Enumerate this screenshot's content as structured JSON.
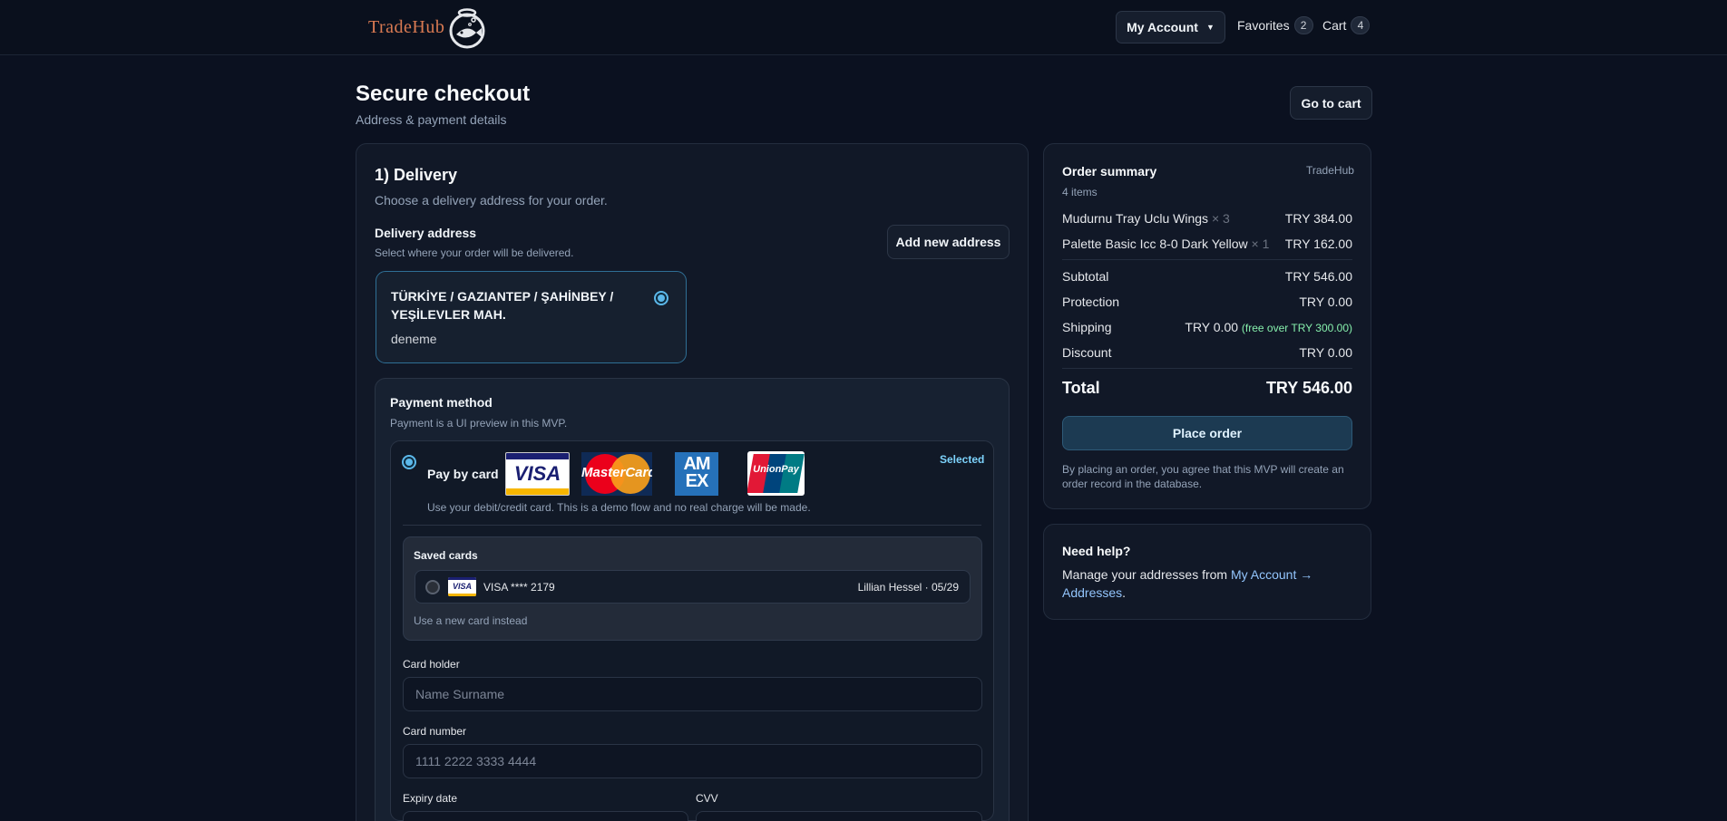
{
  "header": {
    "logo_text": "TradeHub",
    "account_label": "My Account",
    "favorites_label": "Favorites",
    "favorites_count": "2",
    "cart_label": "Cart",
    "cart_count": "4"
  },
  "page": {
    "title": "Secure checkout",
    "subtitle": "Address & payment details",
    "go_to_cart": "Go to cart"
  },
  "delivery": {
    "heading": "1) Delivery",
    "description": "Choose a delivery address for your order.",
    "address_label": "Delivery address",
    "address_help": "Select where your order will be delivered.",
    "add_new_address": "Add new address",
    "selected_address_line1": "TÜRKİYE / GAZIANTEP / ŞAHİNBEY /",
    "selected_address_line2": "YEŞİLEVLER MAH.",
    "selected_address_note": "deneme"
  },
  "payment": {
    "heading": "Payment method",
    "note": "Payment is a UI preview in this MVP.",
    "option_label": "Pay by card",
    "selected_badge": "Selected",
    "option_description": "Use your debit/credit card. This is a demo flow and no real charge will be made.",
    "card_brands": [
      "VISA",
      "MasterCard",
      "AM EX",
      "UnionPay"
    ],
    "saved_cards_heading": "Saved cards",
    "saved_card_label": "VISA **** 2179",
    "saved_card_owner": "Lillian Hessel · 05/29",
    "use_new_card": "Use a new card instead",
    "card_holder_label": "Card holder",
    "card_holder_placeholder": "Name Surname",
    "card_number_label": "Card number",
    "card_number_placeholder": "1111 2222 3333 4444",
    "expiry_label": "Expiry date",
    "cvv_label": "CVV"
  },
  "summary": {
    "heading": "Order summary",
    "brand": "TradeHub",
    "item_count": "4 items",
    "items": [
      {
        "name": "Mudurnu Tray Uclu Wings",
        "qty": "× 3",
        "price": "TRY 384.00"
      },
      {
        "name": "Palette Basic Icc 8-0 Dark Yellow",
        "qty": "× 1",
        "price": "TRY 162.00"
      }
    ],
    "subtotal_label": "Subtotal",
    "subtotal_value": "TRY 546.00",
    "protection_label": "Protection",
    "protection_value": "TRY 0.00",
    "shipping_label": "Shipping",
    "shipping_value": "TRY 0.00",
    "shipping_note": "(free over TRY 300.00)",
    "discount_label": "Discount",
    "discount_value": "TRY 0.00",
    "total_label": "Total",
    "total_value": "TRY 546.00",
    "place_order": "Place order",
    "disclaimer": "By placing an order, you agree that this MVP will create an order record in the database."
  },
  "help": {
    "heading": "Need help?",
    "text": "Manage your addresses from ",
    "link": "My Account → Addresses",
    "suffix": "."
  }
}
